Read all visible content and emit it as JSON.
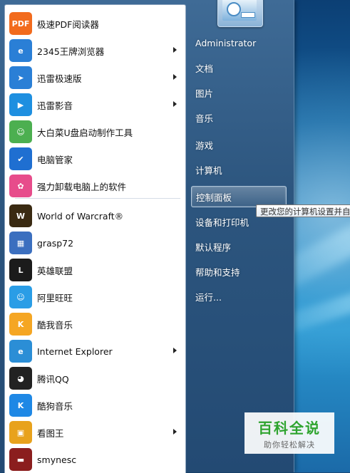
{
  "programs": [
    {
      "label": "极速PDF阅读器",
      "icon": "pdf-reader-icon",
      "color": "#f26b1d",
      "glyph": "PDF",
      "submenu": false
    },
    {
      "label": "2345王牌浏览器",
      "icon": "browser-2345-icon",
      "color": "#2a7fd6",
      "glyph": "e",
      "submenu": true
    },
    {
      "label": "迅雷极速版",
      "icon": "thunder-icon",
      "color": "#2a7fd6",
      "glyph": "➤",
      "submenu": true
    },
    {
      "label": "迅雷影音",
      "icon": "thunder-player-icon",
      "color": "#1e8fe0",
      "glyph": "▶",
      "submenu": true
    },
    {
      "label": "大白菜U盘启动制作工具",
      "icon": "cabbage-usb-icon",
      "color": "#4caf50",
      "glyph": "☺",
      "submenu": false
    },
    {
      "label": "电脑管家",
      "icon": "pc-manager-icon",
      "color": "#1f6fd1",
      "glyph": "✔",
      "submenu": false
    },
    {
      "label": "强力卸载电脑上的软件",
      "icon": "uninstall-icon",
      "color": "#e74c8b",
      "glyph": "✿",
      "submenu": false
    },
    {
      "label": "World of Warcraft®",
      "icon": "warcraft-icon",
      "color": "#3a2a12",
      "glyph": "W",
      "submenu": false
    },
    {
      "label": "grasp72",
      "icon": "grasp-icon",
      "color": "#3b6fbf",
      "glyph": "▦",
      "submenu": false
    },
    {
      "label": "英雄联盟",
      "icon": "league-of-legends-icon",
      "color": "#1b1b1b",
      "glyph": "L",
      "submenu": false
    },
    {
      "label": "阿里旺旺",
      "icon": "aliwangwang-icon",
      "color": "#2a9de6",
      "glyph": "☺",
      "submenu": false
    },
    {
      "label": "酷我音乐",
      "icon": "kuwo-music-icon",
      "color": "#f5a623",
      "glyph": "K",
      "submenu": false
    },
    {
      "label": "Internet Explorer",
      "icon": "internet-explorer-icon",
      "color": "#2b8ed6",
      "glyph": "e",
      "submenu": true
    },
    {
      "label": "腾讯QQ",
      "icon": "qq-penguin-icon",
      "color": "#222222",
      "glyph": "◕",
      "submenu": false
    },
    {
      "label": "酷狗音乐",
      "icon": "kugou-music-icon",
      "color": "#1e88e5",
      "glyph": "K",
      "submenu": false
    },
    {
      "label": "看图王",
      "icon": "image-viewer-icon",
      "color": "#e8a21c",
      "glyph": "▣",
      "submenu": true
    },
    {
      "label": "smynesc",
      "icon": "smynesc-icon",
      "color": "#8b1e1e",
      "glyph": "▬",
      "submenu": false
    }
  ],
  "right_items": [
    {
      "label": "Administrator",
      "active": false
    },
    {
      "label": "文档",
      "active": false
    },
    {
      "label": "图片",
      "active": false
    },
    {
      "label": "音乐",
      "active": false
    },
    {
      "label": "游戏",
      "active": false
    },
    {
      "label": "计算机",
      "active": false
    },
    {
      "label": "控制面板",
      "active": true
    },
    {
      "label": "设备和打印机",
      "active": false
    },
    {
      "label": "默认程序",
      "active": false
    },
    {
      "label": "帮助和支持",
      "active": false
    },
    {
      "label": "运行...",
      "active": false
    }
  ],
  "tooltip": "更改您的计算机设置并自",
  "watermark": {
    "title": "百科全说",
    "subtitle": "助你轻松解决"
  }
}
